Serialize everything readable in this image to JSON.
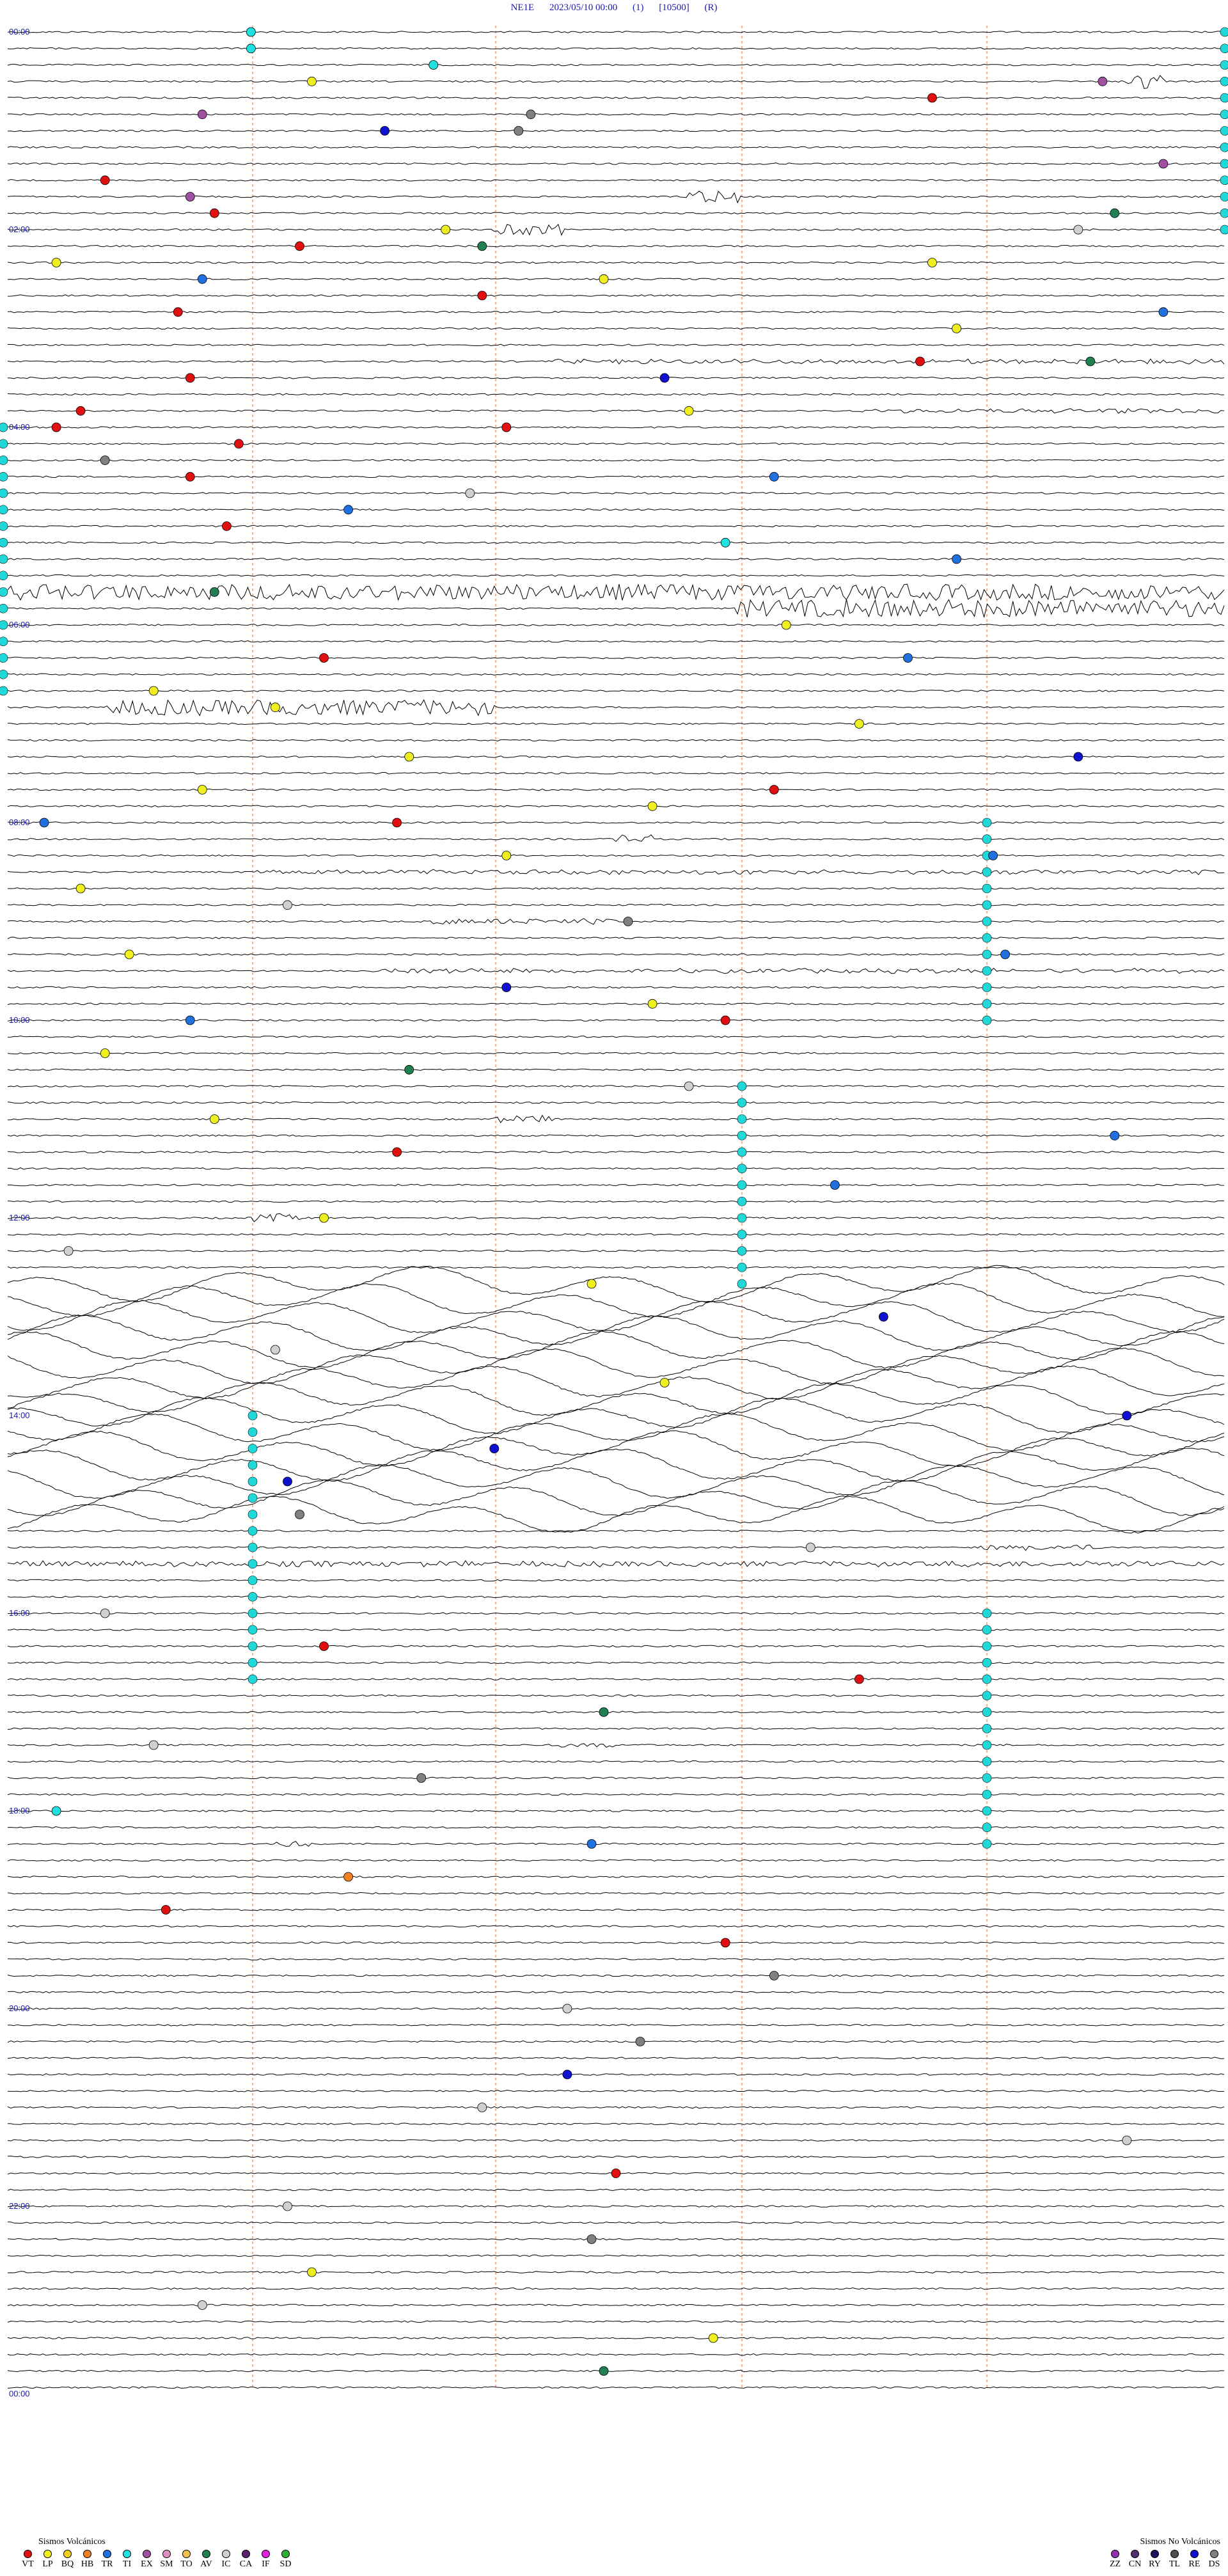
{
  "header": {
    "station": "NE1E",
    "datetime": "2023/05/10 00:00",
    "mode": "(1)",
    "scale": "[10500]",
    "flag": "(R)"
  },
  "hour_labels": [
    "00:00",
    "02:00",
    "04:00",
    "06:00",
    "08:00",
    "10:00",
    "12:00",
    "14:00",
    "16:00",
    "18:00",
    "20:00",
    "22:00",
    "00:00"
  ],
  "colors": {
    "trace": "#000000",
    "marker_line": "#e8a070",
    "label": "#1a1aa8",
    "tremor_band": "#20d8d8"
  },
  "legend_volcanic": {
    "title": "Sismos Volcánicos",
    "items": [
      {
        "code": "VT",
        "color": "#e01010"
      },
      {
        "code": "LP",
        "color": "#f0f020"
      },
      {
        "code": "BQ",
        "color": "#f0d020"
      },
      {
        "code": "HB",
        "color": "#f08020"
      },
      {
        "code": "TR",
        "color": "#2070e0"
      },
      {
        "code": "TI",
        "color": "#20e0e0"
      },
      {
        "code": "EX",
        "color": "#a050a0"
      },
      {
        "code": "SM",
        "color": "#e090c0"
      },
      {
        "code": "TO",
        "color": "#f0c050"
      },
      {
        "code": "AV",
        "color": "#208050"
      },
      {
        "code": "IC",
        "color": "#d0d0d0"
      },
      {
        "code": "CA",
        "color": "#602070"
      },
      {
        "code": "IF",
        "color": "#e020e0"
      },
      {
        "code": "SD",
        "color": "#30b030"
      }
    ]
  },
  "legend_nonvolcanic": {
    "title": "Sismos No Volcánicos",
    "items": [
      {
        "code": "ZZ",
        "color": "#9030b0"
      },
      {
        "code": "CN",
        "color": "#503070"
      },
      {
        "code": "RY",
        "color": "#201060"
      },
      {
        "code": "TL",
        "color": "#505050"
      },
      {
        "code": "RE",
        "color": "#1010d0"
      },
      {
        "code": "DS",
        "color": "#808080"
      }
    ]
  },
  "trace_count": 144,
  "trace_minutes": 10,
  "events": [
    {
      "row": 0,
      "minute": 2.0,
      "type": "TI"
    },
    {
      "row": 1,
      "minute": 2.0,
      "type": "TI"
    },
    {
      "row": 2,
      "minute": 3.5,
      "type": "TI"
    },
    {
      "row": 3,
      "minute": 2.5,
      "type": "LP"
    },
    {
      "row": 3,
      "minute": 9.0,
      "type": "EX"
    },
    {
      "row": 4,
      "minute": 7.6,
      "type": "VT"
    },
    {
      "row": 5,
      "minute": 1.6,
      "type": "EX"
    },
    {
      "row": 5,
      "minute": 4.3,
      "type": "DS"
    },
    {
      "row": 6,
      "minute": 3.1,
      "type": "RE"
    },
    {
      "row": 6,
      "minute": 4.2,
      "type": "DS"
    },
    {
      "row": 8,
      "minute": 9.5,
      "type": "EX"
    },
    {
      "row": 9,
      "minute": 0.8,
      "type": "VT"
    },
    {
      "row": 10,
      "minute": 1.5,
      "type": "EX"
    },
    {
      "row": 11,
      "minute": 1.7,
      "type": "VT"
    },
    {
      "row": 11,
      "minute": 9.1,
      "type": "AV"
    },
    {
      "row": 12,
      "minute": 3.6,
      "type": "LP"
    },
    {
      "row": 12,
      "minute": 8.8,
      "type": "IC"
    },
    {
      "row": 13,
      "minute": 2.4,
      "type": "VT"
    },
    {
      "row": 13,
      "minute": 3.9,
      "type": "AV"
    },
    {
      "row": 14,
      "minute": 0.4,
      "type": "LP"
    },
    {
      "row": 14,
      "minute": 7.6,
      "type": "LP"
    },
    {
      "row": 15,
      "minute": 1.6,
      "type": "TR"
    },
    {
      "row": 15,
      "minute": 4.9,
      "type": "LP"
    },
    {
      "row": 16,
      "minute": 3.9,
      "type": "VT"
    },
    {
      "row": 17,
      "minute": 1.4,
      "type": "VT"
    },
    {
      "row": 17,
      "minute": 9.5,
      "type": "TR"
    },
    {
      "row": 18,
      "minute": 7.8,
      "type": "LP"
    },
    {
      "row": 20,
      "minute": 7.5,
      "type": "VT"
    },
    {
      "row": 20,
      "minute": 8.9,
      "type": "AV"
    },
    {
      "row": 21,
      "minute": 1.5,
      "type": "VT"
    },
    {
      "row": 21,
      "minute": 5.4,
      "type": "RE"
    },
    {
      "row": 23,
      "minute": 0.6,
      "type": "VT"
    },
    {
      "row": 23,
      "minute": 5.6,
      "type": "LP"
    },
    {
      "row": 24,
      "minute": 0.4,
      "type": "VT"
    },
    {
      "row": 24,
      "minute": 4.1,
      "type": "VT"
    },
    {
      "row": 25,
      "minute": 1.9,
      "type": "VT"
    },
    {
      "row": 26,
      "minute": 0.8,
      "type": "DS"
    },
    {
      "row": 27,
      "minute": 1.5,
      "type": "VT"
    },
    {
      "row": 27,
      "minute": 6.3,
      "type": "TR"
    },
    {
      "row": 28,
      "minute": 3.8,
      "type": "IC"
    },
    {
      "row": 29,
      "minute": 2.8,
      "type": "TR"
    },
    {
      "row": 30,
      "minute": 1.8,
      "type": "VT"
    },
    {
      "row": 31,
      "minute": 5.9,
      "type": "TI"
    },
    {
      "row": 32,
      "minute": 7.8,
      "type": "TR"
    },
    {
      "row": 34,
      "minute": 1.7,
      "type": "AV"
    },
    {
      "row": 36,
      "minute": 6.4,
      "type": "LP"
    },
    {
      "row": 38,
      "minute": 2.6,
      "type": "VT"
    },
    {
      "row": 38,
      "minute": 7.4,
      "type": "TR"
    },
    {
      "row": 40,
      "minute": 1.2,
      "type": "LP"
    },
    {
      "row": 41,
      "minute": 2.2,
      "type": "LP"
    },
    {
      "row": 42,
      "minute": 7.0,
      "type": "LP"
    },
    {
      "row": 44,
      "minute": 3.3,
      "type": "LP"
    },
    {
      "row": 44,
      "minute": 8.8,
      "type": "RE"
    },
    {
      "row": 46,
      "minute": 6.3,
      "type": "VT"
    },
    {
      "row": 46,
      "minute": 1.6,
      "type": "LP"
    },
    {
      "row": 47,
      "minute": 5.3,
      "type": "LP"
    },
    {
      "row": 48,
      "minute": 3.2,
      "type": "VT"
    },
    {
      "row": 48,
      "minute": 0.3,
      "type": "TR"
    },
    {
      "row": 50,
      "minute": 4.1,
      "type": "LP"
    },
    {
      "row": 50,
      "minute": 8.1,
      "type": "TR"
    },
    {
      "row": 52,
      "minute": 0.6,
      "type": "LP"
    },
    {
      "row": 53,
      "minute": 2.3,
      "type": "IC"
    },
    {
      "row": 54,
      "minute": 5.1,
      "type": "DS"
    },
    {
      "row": 56,
      "minute": 1.0,
      "type": "LP"
    },
    {
      "row": 56,
      "minute": 8.2,
      "type": "TR"
    },
    {
      "row": 58,
      "minute": 4.1,
      "type": "RE"
    },
    {
      "row": 59,
      "minute": 5.3,
      "type": "LP"
    },
    {
      "row": 60,
      "minute": 1.5,
      "type": "TR"
    },
    {
      "row": 60,
      "minute": 5.9,
      "type": "VT"
    },
    {
      "row": 62,
      "minute": 0.8,
      "type": "LP"
    },
    {
      "row": 63,
      "minute": 3.3,
      "type": "AV"
    },
    {
      "row": 64,
      "minute": 5.6,
      "type": "IC"
    },
    {
      "row": 66,
      "minute": 1.7,
      "type": "LP"
    },
    {
      "row": 67,
      "minute": 9.1,
      "type": "TR"
    },
    {
      "row": 68,
      "minute": 3.2,
      "type": "VT"
    },
    {
      "row": 70,
      "minute": 6.8,
      "type": "TR"
    },
    {
      "row": 72,
      "minute": 2.6,
      "type": "LP"
    },
    {
      "row": 74,
      "minute": 0.5,
      "type": "IC"
    },
    {
      "row": 76,
      "minute": 4.8,
      "type": "LP"
    },
    {
      "row": 78,
      "minute": 7.2,
      "type": "RE"
    },
    {
      "row": 80,
      "minute": 2.2,
      "type": "IC"
    },
    {
      "row": 82,
      "minute": 5.4,
      "type": "LP"
    },
    {
      "row": 84,
      "minute": 9.2,
      "type": "RE"
    },
    {
      "row": 86,
      "minute": 4.0,
      "type": "RE"
    },
    {
      "row": 88,
      "minute": 2.3,
      "type": "RE"
    },
    {
      "row": 90,
      "minute": 2.4,
      "type": "DS"
    },
    {
      "row": 92,
      "minute": 6.6,
      "type": "IC"
    },
    {
      "row": 96,
      "minute": 0.8,
      "type": "IC"
    },
    {
      "row": 98,
      "minute": 2.6,
      "type": "VT"
    },
    {
      "row": 100,
      "minute": 7.0,
      "type": "VT"
    },
    {
      "row": 102,
      "minute": 4.9,
      "type": "AV"
    },
    {
      "row": 104,
      "minute": 1.2,
      "type": "IC"
    },
    {
      "row": 106,
      "minute": 3.4,
      "type": "DS"
    },
    {
      "row": 108,
      "minute": 0.4,
      "type": "TI"
    },
    {
      "row": 110,
      "minute": 4.8,
      "type": "TR"
    },
    {
      "row": 112,
      "minute": 2.8,
      "type": "HB"
    },
    {
      "row": 114,
      "minute": 1.3,
      "type": "VT"
    },
    {
      "row": 116,
      "minute": 5.9,
      "type": "VT"
    },
    {
      "row": 118,
      "minute": 6.3,
      "type": "DS"
    },
    {
      "row": 120,
      "minute": 4.6,
      "type": "IC"
    },
    {
      "row": 122,
      "minute": 5.2,
      "type": "DS"
    },
    {
      "row": 124,
      "minute": 4.6,
      "type": "RE"
    },
    {
      "row": 126,
      "minute": 3.9,
      "type": "IC"
    },
    {
      "row": 128,
      "minute": 9.2,
      "type": "IC"
    },
    {
      "row": 130,
      "minute": 5.0,
      "type": "VT"
    },
    {
      "row": 132,
      "minute": 2.3,
      "type": "IC"
    },
    {
      "row": 134,
      "minute": 4.8,
      "type": "DS"
    },
    {
      "row": 136,
      "minute": 2.5,
      "type": "LP"
    },
    {
      "row": 138,
      "minute": 1.6,
      "type": "IC"
    },
    {
      "row": 140,
      "minute": 5.8,
      "type": "LP"
    },
    {
      "row": 142,
      "minute": 4.9,
      "type": "AV"
    }
  ]
}
